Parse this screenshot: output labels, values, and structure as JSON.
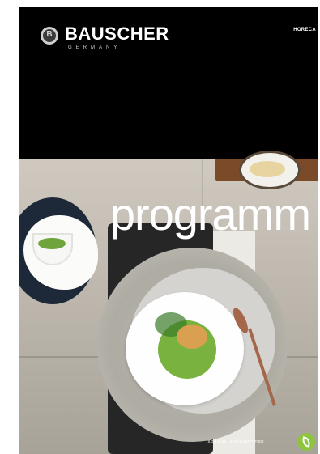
{
  "brand": {
    "name": "BAUSCHER",
    "country": "GERMANY",
    "segment": "HORECA"
  },
  "cover": {
    "headline": "programm"
  },
  "certification": {
    "text": "ISO 14001 / 50001 CERTIFIED"
  },
  "colors": {
    "header_band": "#000000",
    "headline": "#ffffff",
    "certification_badge": "#8cc63f"
  }
}
